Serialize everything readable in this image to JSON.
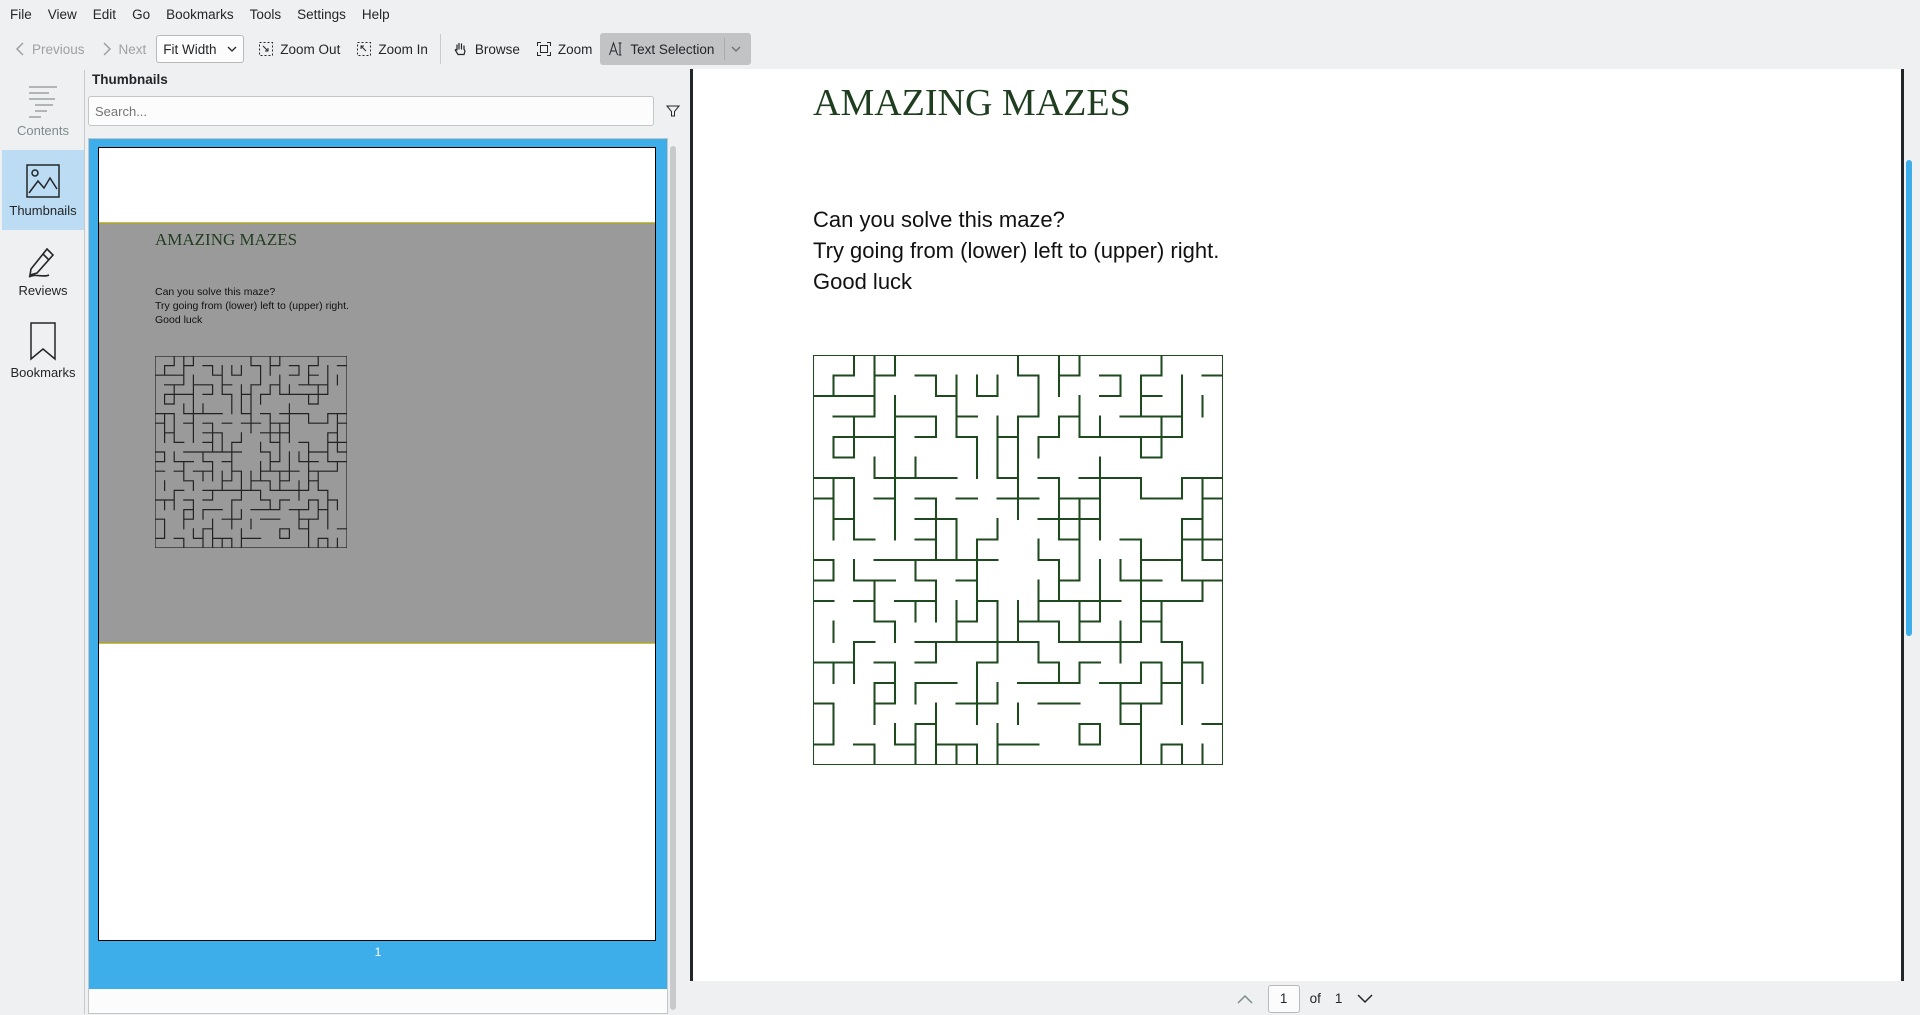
{
  "menubar": [
    "File",
    "View",
    "Edit",
    "Go",
    "Bookmarks",
    "Tools",
    "Settings",
    "Help"
  ],
  "toolbar": {
    "previous": "Previous",
    "next": "Next",
    "zoom_mode": "Fit Width",
    "zoom_out": "Zoom Out",
    "zoom_in": "Zoom In",
    "browse": "Browse",
    "zoom": "Zoom",
    "text_selection": "Text Selection"
  },
  "sidebar": {
    "items": [
      {
        "label": "Contents",
        "icon": "contents-icon"
      },
      {
        "label": "Thumbnails",
        "icon": "thumbnails-icon"
      },
      {
        "label": "Reviews",
        "icon": "reviews-icon"
      },
      {
        "label": "Bookmarks",
        "icon": "bookmarks-icon"
      }
    ],
    "active": "Thumbnails"
  },
  "thumbnails": {
    "title": "Thumbnails",
    "search_placeholder": "Search...",
    "page_number": "1"
  },
  "document": {
    "title": "AMAZING MAZES",
    "lines": [
      "Can you solve this maze?",
      "Try going from (lower) left to (upper) right.",
      "Good luck"
    ],
    "colors": {
      "maze": "#1f4a1f",
      "title": "#1f3d1f"
    }
  },
  "pagination": {
    "current": "1",
    "of_label": "of",
    "total": "1"
  }
}
